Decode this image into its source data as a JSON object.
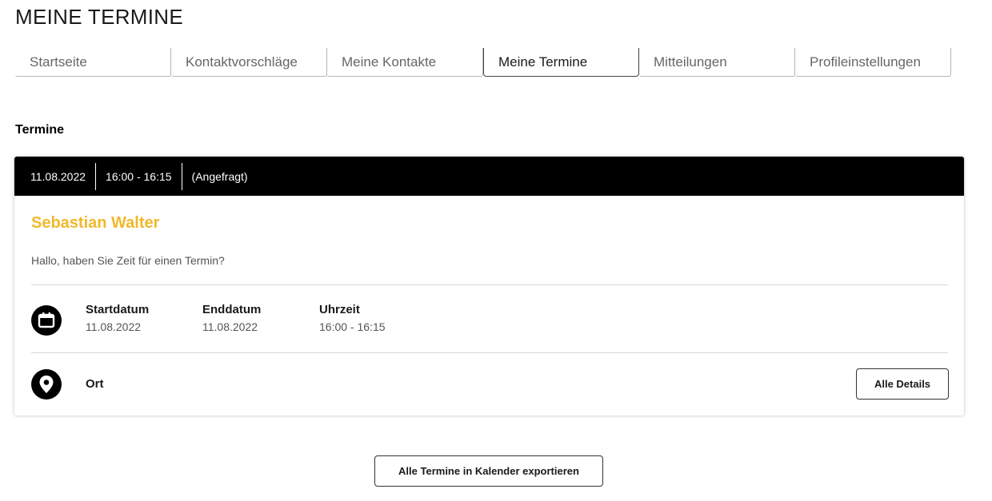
{
  "page": {
    "title": "MEINE TERMINE"
  },
  "tabs": [
    {
      "label": "Startseite",
      "active": false
    },
    {
      "label": "Kontaktvorschläge",
      "active": false
    },
    {
      "label": "Meine Kontakte",
      "active": false
    },
    {
      "label": "Meine Termine",
      "active": true
    },
    {
      "label": "Mitteilungen",
      "active": false
    },
    {
      "label": "Profileinstellungen",
      "active": false
    }
  ],
  "section": {
    "heading": "Termine"
  },
  "appointment": {
    "header": {
      "date": "11.08.2022",
      "time": "16:00 - 16:15",
      "status": "(Angefragt)"
    },
    "name": "Sebastian Walter",
    "message": "Hallo, haben Sie Zeit für einen Termin?",
    "start": {
      "label": "Startdatum",
      "value": "11.08.2022"
    },
    "end": {
      "label": "Enddatum",
      "value": "11.08.2022"
    },
    "time": {
      "label": "Uhrzeit",
      "value": "16:00 - 16:15"
    },
    "location": {
      "label": "Ort"
    },
    "details_button": "Alle Details",
    "icons": {
      "date": "calendar-icon",
      "location": "map-pin-icon"
    }
  },
  "export_button": "Alle Termine in Kalender exportieren",
  "colors": {
    "accent": "#f0b92b",
    "header_bg": "#000000"
  }
}
